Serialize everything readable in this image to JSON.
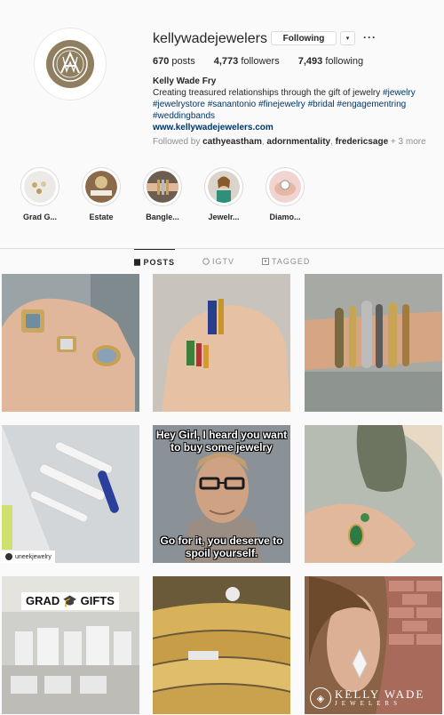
{
  "profile": {
    "username": "kellywadejewelers",
    "follow_label": "Following",
    "dropdown_glyph": "▾",
    "more_glyph": "···",
    "stats": {
      "posts_count": "670",
      "posts_label": "posts",
      "followers_count": "4,773",
      "followers_label": "followers",
      "following_count": "7,493",
      "following_label": "following"
    },
    "bio": {
      "full_name": "Kelly Wade Fry",
      "line1_text": "Creating treasured relationships through the gift of jewelry",
      "tags": [
        "#jewelry",
        "#jewelrystore",
        "#sanantonio",
        "#finejewelry",
        "#bridal",
        "#engagementring",
        "#weddingbands"
      ],
      "website": "www.kellywadejewelers.com"
    },
    "followed_by": {
      "prefix": "Followed by",
      "users": [
        "cathyeastham",
        "adornmentality",
        "fredericsage"
      ],
      "more": "+ 3 more"
    }
  },
  "highlights": [
    {
      "label": "Grad G..."
    },
    {
      "label": "Estate"
    },
    {
      "label": "Bangle..."
    },
    {
      "label": "Jewelr..."
    },
    {
      "label": "Diamo..."
    }
  ],
  "tabs": [
    {
      "label": "POSTS",
      "icon": "grid-icon",
      "active": true
    },
    {
      "label": "IGTV",
      "icon": "igtv-icon",
      "active": false
    },
    {
      "label": "TAGGED",
      "icon": "tag-icon",
      "active": false
    }
  ],
  "posts": {
    "meme_top": "Hey Girl, I heard you want to buy some jewelry",
    "meme_bottom": "Go for it, you deserve to spoil yourself.",
    "repost_user": "uneekjewelry",
    "repost_watermark": "uneek",
    "grad_sign": "GRAD 🎓 GIFTS",
    "brand_line1": "KELLY WADE",
    "brand_line2": "JEWELERS"
  },
  "colors": {
    "link": "#003569",
    "brand_gold": "#8f7f60",
    "muted": "#8e8e8e"
  }
}
